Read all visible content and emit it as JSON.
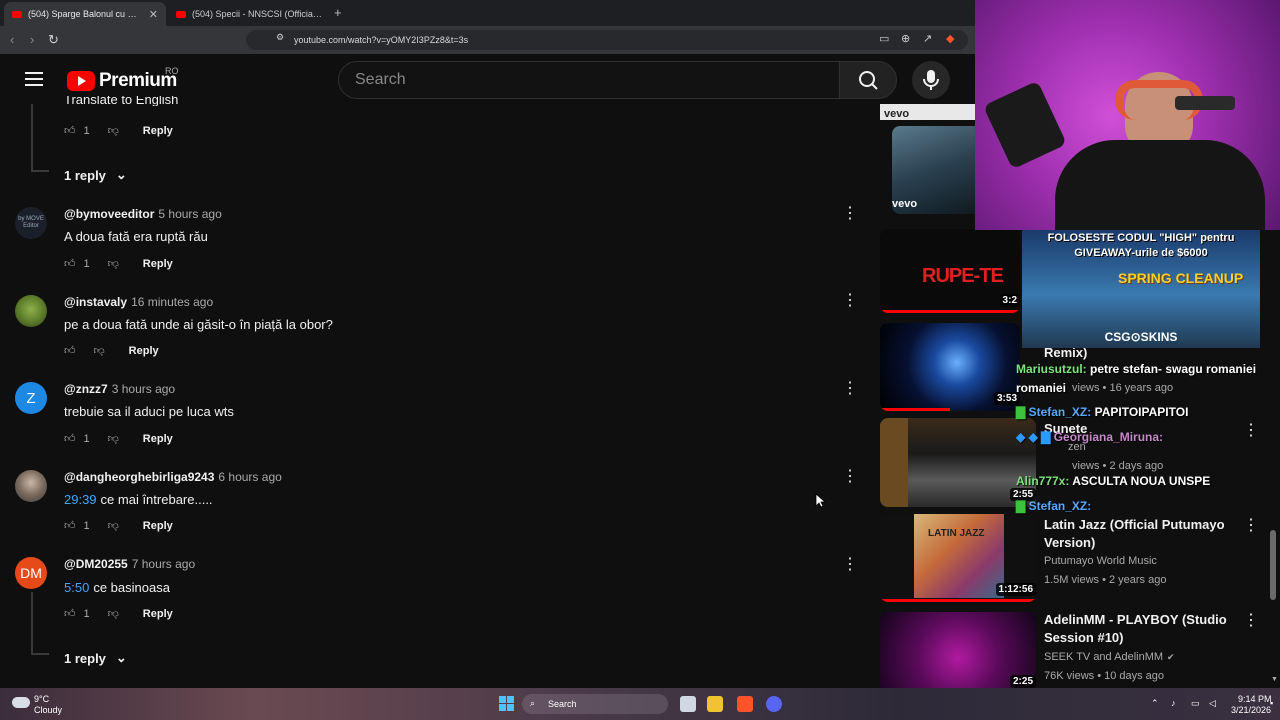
{
  "browser": {
    "tabs": [
      {
        "title": "(504) Sparge Balonul cu Ghebo...",
        "active": true
      },
      {
        "title": "(504) Specii - NNSCSI (Official Video)",
        "active": false
      }
    ],
    "url": "youtube.com/watch?v=yOMY2I3PZz8&t=3s"
  },
  "header": {
    "logo_text": "Premium",
    "country_code": "RO",
    "search_placeholder": "Search"
  },
  "comments": {
    "top_partial": {
      "text": "Translate to English",
      "likes": "1",
      "reply_label": "Reply",
      "replies_toggle": "1 reply"
    },
    "items": [
      {
        "author": "@bymoveeditor",
        "time": "5 hours ago",
        "timestamp": "",
        "text": "A doua fată era ruptă rău",
        "likes": "1",
        "reply_label": "Reply",
        "avatar_text": "by MOVE Editor"
      },
      {
        "author": "@instavaly",
        "time": "16 minutes ago",
        "timestamp": "",
        "text": "pe a doua fată unde ai găsit-o în piață la obor?",
        "likes": "",
        "reply_label": "Reply",
        "avatar_text": ""
      },
      {
        "author": "@znzz7",
        "time": "3 hours ago",
        "timestamp": "",
        "text": "trebuie sa il aduci pe luca wts",
        "likes": "1",
        "reply_label": "Reply",
        "avatar_text": "Z"
      },
      {
        "author": "@dangheorghebirliga9243",
        "time": "6 hours ago",
        "timestamp": "29:39",
        "text": "ce mai întrebare.....",
        "likes": "1",
        "reply_label": "Reply",
        "avatar_text": ""
      },
      {
        "author": "@DM20255",
        "time": "7 hours ago",
        "timestamp": "5:50",
        "text": "ce basinoasa",
        "likes": "1",
        "reply_label": "Reply",
        "avatar_text": "DM"
      }
    ],
    "bottom_replies_toggle": "1 reply"
  },
  "recommendations": [
    {
      "duration": "",
      "label": "vevo"
    },
    {
      "duration": "",
      "label": "vevo"
    },
    {
      "duration": "3:2",
      "thumb_text": "RUPE-TE"
    },
    {
      "duration": "3:53"
    },
    {
      "duration": "2:55"
    },
    {
      "duration": "1:12:56",
      "title": "Latin Jazz (Official Putumayo Version)",
      "channel": "Putumayo World Music",
      "stats": "1.5M views • 2 years ago",
      "thumb_text": "LATIN JAZZ"
    },
    {
      "duration": "2:25",
      "title": "AdelinMM - PLAYBOY (Studio Session #10)",
      "channel": "SEEK TV and AdelinMM",
      "stats": "76K views • 10 days ago"
    }
  ],
  "overlay_rec_text": {
    "remix": "Remix)",
    "views1": "views • 16 years ago",
    "sunete": "Sunete",
    "zen": "zen",
    "views2": "views • 2 days ago"
  },
  "sponsor_banner": {
    "line1": "FOLOSESTE CODUL \"HIGH\" pentru",
    "line2": "GIVEAWAY-urile de $6000",
    "event": "SPRING CLEANUP",
    "brand": "CSG⊙SKINS"
  },
  "stream_chat": [
    {
      "user": "Mariusutzul:",
      "msg": "petre stefan- swagu romaniei"
    },
    {
      "user": "Stefan_XZ:",
      "msg": "PAPITOIPAPITOI"
    },
    {
      "user": "Georgiana_Miruna:",
      "msg": ""
    },
    {
      "user": "Alin777x:",
      "msg": "ASCULTA NOUA UNSPE"
    },
    {
      "user": "Stefan_XZ:",
      "msg": ""
    }
  ],
  "taskbar": {
    "weather_temp": "9°C",
    "weather_desc": "Cloudy",
    "search_label": "Search",
    "time": "9:14 PM",
    "date": "3/21/2026"
  },
  "colors": {
    "background": "#0f0f0f",
    "link_timestamp": "#3ea6ff",
    "youtube_red": "#ff0000",
    "webcam_magenta": "#d236d8"
  }
}
